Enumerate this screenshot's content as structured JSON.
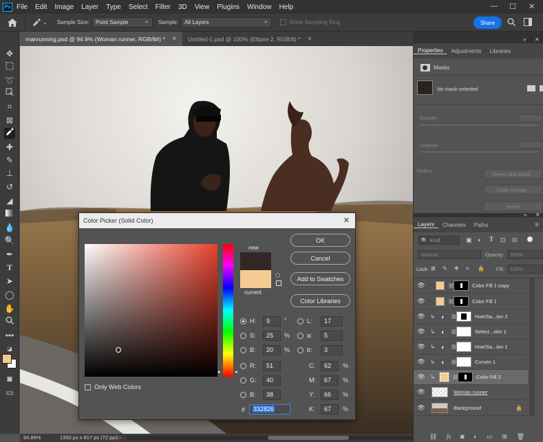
{
  "menubar": {
    "logo": "Ps",
    "items": [
      "File",
      "Edit",
      "Image",
      "Layer",
      "Type",
      "Select",
      "Filter",
      "3D",
      "View",
      "Plugins",
      "Window",
      "Help"
    ],
    "controls": [
      "—",
      "☐",
      "✕"
    ]
  },
  "optionsbar": {
    "sample_size_label": "Sample Size:",
    "sample_size_value": "Point Sample",
    "sample_label": "Sample:",
    "sample_value": "All Layers",
    "show_ring_label": "Show Sampling Ring",
    "share_label": "Share"
  },
  "tabs": [
    {
      "label": "manrunning.psd @ 94.9% (Woman runner, RGB/8#) *",
      "close": "✕"
    },
    {
      "label": "Untitled-1.psd @ 100% (Ellipse 2, RGB/8) *",
      "close": "✕"
    }
  ],
  "statusbar": {
    "zoom": "94.89%",
    "doc_info": "1300 px x 817 px (72 ppi)"
  },
  "properties": {
    "tabs": [
      "Properties",
      "Adjustments",
      "Libraries"
    ],
    "section": "Masks",
    "mask_status": "No mask selected",
    "density_label": "Density:",
    "feather_label": "Feather:",
    "refine_label": "Refine:",
    "select_mask_btn": "Select and Mask...",
    "color_range_btn": "Color Range...",
    "invert_btn": "Invert"
  },
  "layers_panel": {
    "tabs": [
      "Layers",
      "Channels",
      "Paths"
    ],
    "filter_kind": "Kind",
    "blend_mode": "Normal",
    "opacity_label": "Opacity:",
    "opacity_value": "100%",
    "lock_label": "Lock:",
    "fill_label": "Fill:",
    "fill_value": "100%",
    "layers": [
      {
        "name": "Color Fill 1 copy",
        "type": "fill"
      },
      {
        "name": "Color Fill 1",
        "type": "fill"
      },
      {
        "name": "Hue/Sa...ion 2",
        "type": "hue"
      },
      {
        "name": "Select...olor 1",
        "type": "selective"
      },
      {
        "name": "Hue/Sa...ion 1",
        "type": "hue"
      },
      {
        "name": "Curves 1",
        "type": "curves"
      },
      {
        "name": "Color Fill 2",
        "type": "fill-selected"
      },
      {
        "name": "Woman runner",
        "type": "pixel"
      },
      {
        "name": "Background",
        "type": "background"
      }
    ],
    "footer_icons": [
      "link-icon",
      "fx-icon",
      "mask-icon",
      "adjustment-icon",
      "group-icon",
      "new-layer-icon",
      "trash-icon"
    ]
  },
  "color_picker": {
    "title": "Color Picker (Solid Color)",
    "new_label": "new",
    "current_label": "current",
    "ok_label": "OK",
    "cancel_label": "Cancel",
    "add_swatches_label": "Add to Swatches",
    "color_libraries_label": "Color Libraries",
    "only_web_colors_label": "Only Web Colors",
    "new_color": "#332826",
    "current_color": "#f5cb93",
    "hue_color": "#e8412c",
    "fields": {
      "H": {
        "value": "9",
        "unit": "°"
      },
      "S": {
        "value": "25",
        "unit": "%"
      },
      "Bri": {
        "value": "20",
        "unit": "%"
      },
      "R": {
        "value": "51",
        "unit": ""
      },
      "G": {
        "value": "40",
        "unit": ""
      },
      "Bl": {
        "value": "38",
        "unit": ""
      },
      "L": {
        "value": "17",
        "unit": ""
      },
      "a": {
        "value": "5",
        "unit": ""
      },
      "b": {
        "value": "3",
        "unit": ""
      },
      "C": {
        "value": "62",
        "unit": "%"
      },
      "M": {
        "value": "67",
        "unit": "%"
      },
      "Y": {
        "value": "66",
        "unit": "%"
      },
      "K": {
        "value": "67",
        "unit": "%"
      }
    },
    "labels": {
      "H": "H:",
      "S": "S:",
      "Bri": "B:",
      "R": "R:",
      "G": "G:",
      "Bl": "B:",
      "L": "L:",
      "a": "a:",
      "b": "b:",
      "C": "C:",
      "M": "M:",
      "Y": "Y:",
      "K": "K:",
      "hex": "#"
    },
    "hex_value": "332826"
  },
  "colors": {
    "foreground": "#f5cb93",
    "background": "#ffffff",
    "accent": "#1473e6"
  }
}
